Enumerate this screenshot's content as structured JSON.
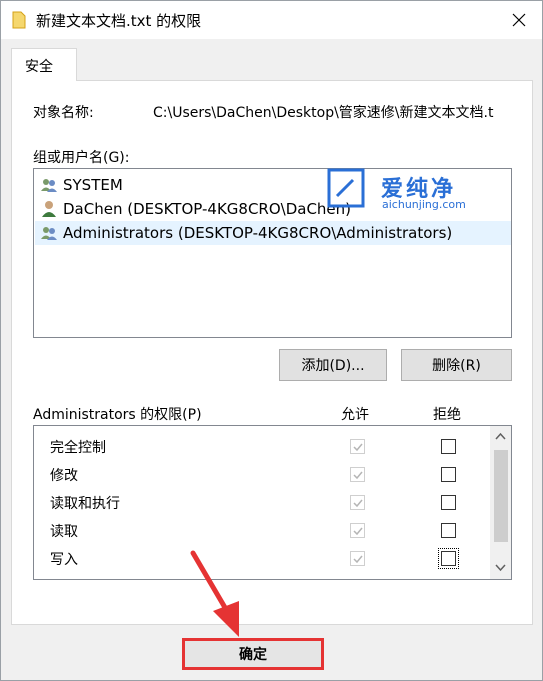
{
  "window": {
    "title": "新建文本文档.txt 的权限"
  },
  "tabs": [
    {
      "label": "安全"
    }
  ],
  "object": {
    "label": "对象名称:",
    "value": "C:\\Users\\DaChen\\Desktop\\管家速修\\新建文本文档.t"
  },
  "groups": {
    "label": "组或用户名(G):",
    "items": [
      {
        "label": "SYSTEM",
        "icon": "users-icon"
      },
      {
        "label": "DaChen (DESKTOP-4KG8CRO\\DaChen)",
        "icon": "user-icon"
      },
      {
        "label": "Administrators (DESKTOP-4KG8CRO\\Administrators)",
        "icon": "users-icon",
        "selected": true
      }
    ]
  },
  "buttons": {
    "add": "添加(D)...",
    "remove": "删除(R)",
    "ok": "确定"
  },
  "permissions": {
    "label": "Administrators 的权限(P)",
    "allow_header": "允许",
    "deny_header": "拒绝",
    "rows": [
      {
        "label": "完全控制",
        "allow": true,
        "deny": false
      },
      {
        "label": "修改",
        "allow": true,
        "deny": false
      },
      {
        "label": "读取和执行",
        "allow": true,
        "deny": false
      },
      {
        "label": "读取",
        "allow": true,
        "deny": false
      },
      {
        "label": "写入",
        "allow": true,
        "deny": false
      }
    ]
  },
  "watermark": {
    "text": "爱纯净",
    "sub": "aichunjing.com"
  },
  "colors": {
    "highlight": "#e53333",
    "selection": "#e5f3ff",
    "watermark": "#2a6fd6"
  }
}
